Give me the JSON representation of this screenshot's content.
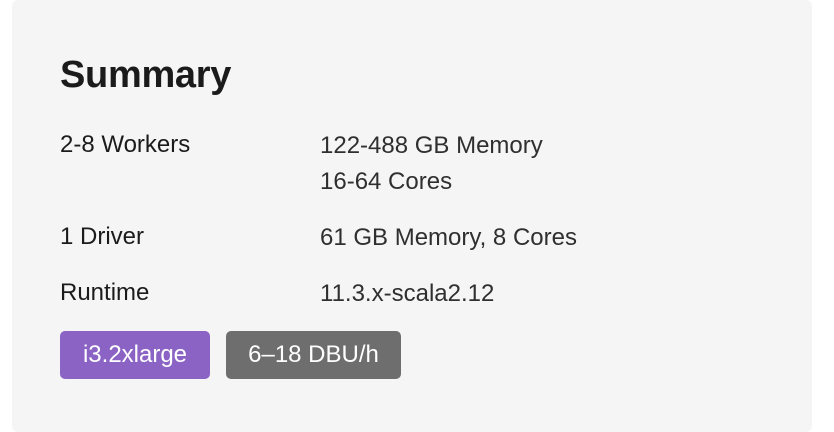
{
  "summary": {
    "title": "Summary",
    "rows": [
      {
        "label": "2-8 Workers",
        "values": [
          "122-488 GB Memory",
          "16-64 Cores"
        ]
      },
      {
        "label": "1 Driver",
        "values": [
          "61 GB Memory, 8 Cores"
        ]
      },
      {
        "label": "Runtime",
        "values": [
          "11.3.x-scala2.12"
        ]
      }
    ],
    "badges": {
      "instance": {
        "label": "i3.2xlarge",
        "color": "#8a63c4"
      },
      "dbu": {
        "label": "6–18 DBU/h",
        "color": "#6e6e6e"
      }
    }
  }
}
